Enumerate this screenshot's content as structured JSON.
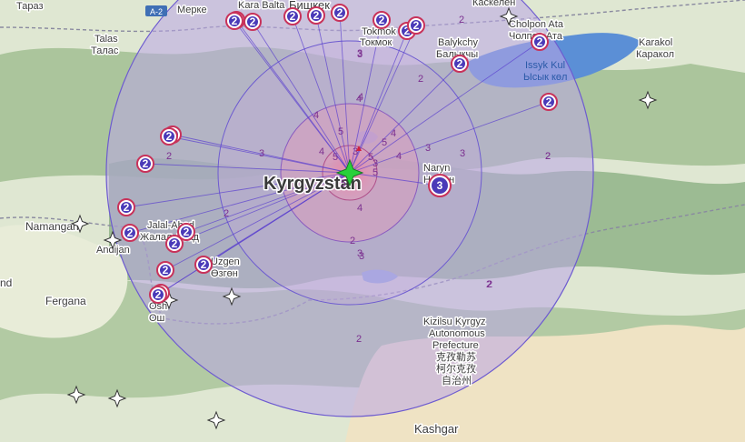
{
  "map": {
    "colors": {
      "ring_fill": "#b9a6e6",
      "ring_stroke": "#6d5bd0",
      "inner_fill": "#e39ab8",
      "ray": "#5a3fcf",
      "badge_fill": "#c8325a",
      "badge_ring": "#4a3ab8",
      "epicenter": "#28d13a",
      "water": "#5b8fd6",
      "land": "#dfe7d2",
      "mountain": "#7da57a",
      "desert": "#efe3c4"
    },
    "country_label": "Kyrgyzstan",
    "highway_shield": "A-2",
    "places": [
      {
        "id": "taraz",
        "name": "Тараз"
      },
      {
        "id": "merki",
        "name": "Мерке"
      },
      {
        "id": "kara-balta",
        "name": "Kara Balta"
      },
      {
        "id": "bishkek",
        "name": "Бишкек"
      },
      {
        "id": "kaskelen",
        "name": "Каскелен"
      },
      {
        "id": "talas",
        "name": "Talas"
      },
      {
        "id": "talas-cyr",
        "name": "Талас"
      },
      {
        "id": "tokmok",
        "name": "Tokmok"
      },
      {
        "id": "tokmok-cyr",
        "name": "Токмок"
      },
      {
        "id": "cholpon-ata",
        "name": "Cholpon Ata"
      },
      {
        "id": "cholpon-ata-cyr",
        "name": "Чолпон Ата"
      },
      {
        "id": "balykchy",
        "name": "Balykchy"
      },
      {
        "id": "balykchy-cyr",
        "name": "Балыкчы"
      },
      {
        "id": "karakol",
        "name": "Karakol"
      },
      {
        "id": "karakol-cyr",
        "name": "Каракол"
      },
      {
        "id": "issyk-kul",
        "name": "Issyk Kul"
      },
      {
        "id": "issyk-kul-cyr",
        "name": "Ысык көл"
      },
      {
        "id": "naryn",
        "name": "Naryn"
      },
      {
        "id": "naryn-cyr",
        "name": "Нарын"
      },
      {
        "id": "namangan",
        "name": "Namangan"
      },
      {
        "id": "andijan",
        "name": "Andijan"
      },
      {
        "id": "jalal-abad",
        "name": "Jalal-Abad"
      },
      {
        "id": "jalal-abad-cyr",
        "name": "Жалал-Абад"
      },
      {
        "id": "uzgen",
        "name": "Uzgen"
      },
      {
        "id": "uzgen-cyr",
        "name": "Өзгөн"
      },
      {
        "id": "fergana",
        "name": "Fergana"
      },
      {
        "id": "osh",
        "name": "Osh"
      },
      {
        "id": "osh-cyr",
        "name": "Ош"
      },
      {
        "id": "nd",
        "name": "nd"
      },
      {
        "id": "kizilsu-1",
        "name": "Kizilsu Kyrgyz"
      },
      {
        "id": "kizilsu-2",
        "name": "Autonomous"
      },
      {
        "id": "kizilsu-3",
        "name": "Prefecture"
      },
      {
        "id": "kizilsu-4",
        "name": "克孜勒苏"
      },
      {
        "id": "kizilsu-5",
        "name": "柯尔克孜"
      },
      {
        "id": "kizilsu-6",
        "name": "自治州"
      },
      {
        "id": "kashgar",
        "name": "Kashgar"
      }
    ],
    "intensity_marks": [
      "2",
      "2",
      "2",
      "2",
      "2",
      "3",
      "3",
      "3",
      "3",
      "3",
      "3",
      "3",
      "4",
      "4",
      "4",
      "4",
      "4",
      "4",
      "5",
      "5",
      "5",
      "5",
      "5",
      "5",
      "4",
      "3",
      "3",
      "2",
      "2",
      "2",
      "2",
      "2",
      "2"
    ],
    "station_badges": [
      "2",
      "2",
      "2",
      "2",
      "2",
      "2",
      "2",
      "2",
      "2",
      "2",
      "2",
      "2",
      "3",
      "2",
      "2",
      "2",
      "2",
      "2",
      "2",
      "2",
      "2",
      "2",
      "2",
      "2"
    ]
  }
}
